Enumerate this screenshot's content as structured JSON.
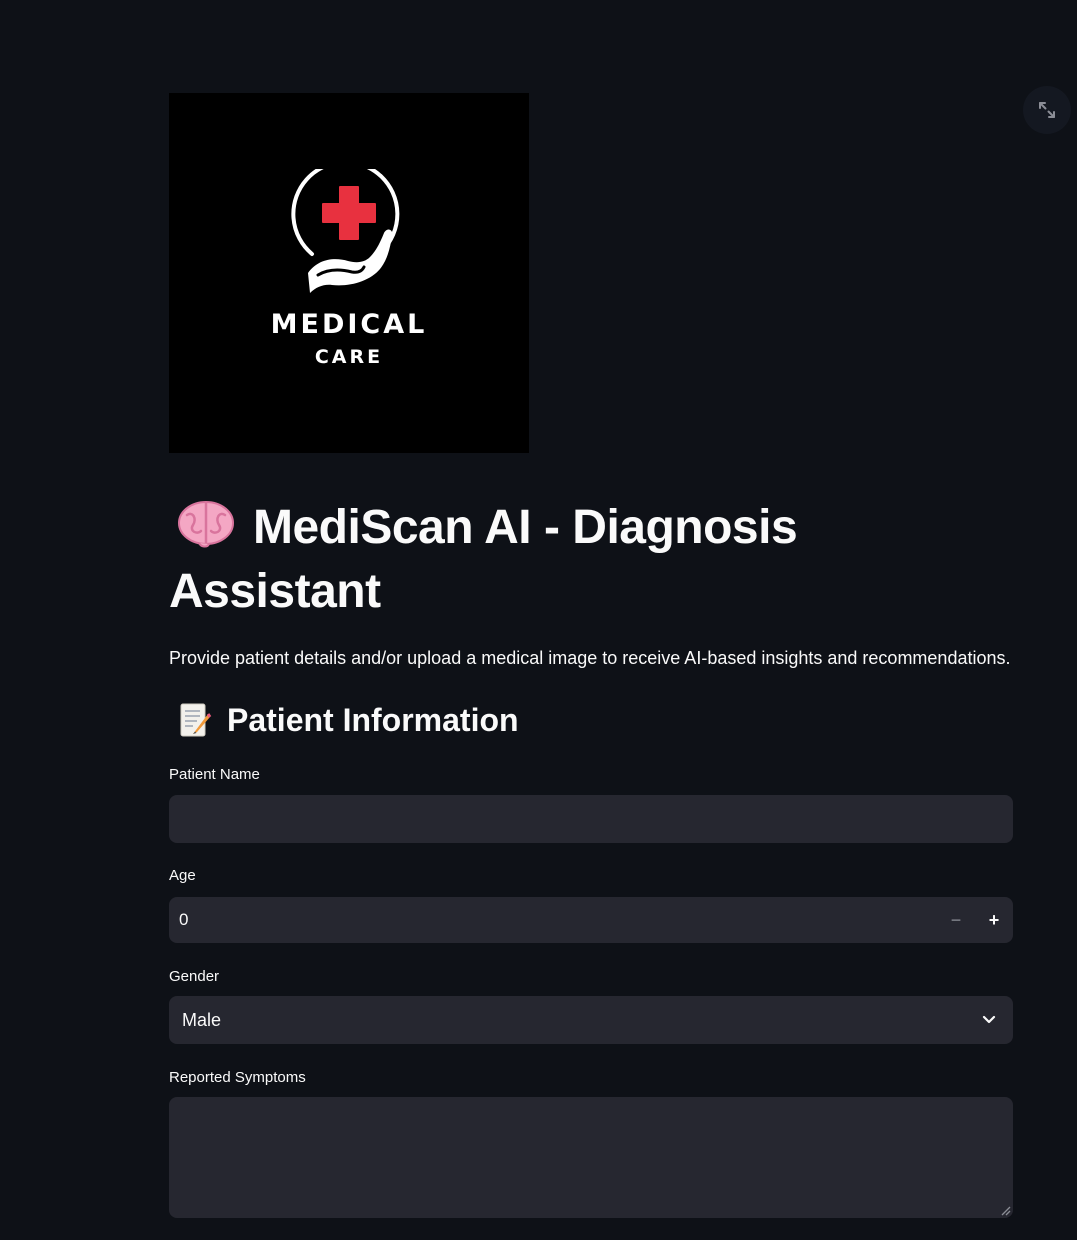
{
  "toolbar": {
    "fullscreen_icon": "expand-arrows-icon"
  },
  "logo": {
    "word1": "MEDICAL",
    "word2": "CARE",
    "icon": "hand-holding-medical-cross-icon",
    "cross_color": "#e8313f"
  },
  "header": {
    "emoji": "brain-icon",
    "title": "MediScan AI - Diagnosis Assistant",
    "subtitle": "Provide patient details and/or upload a medical image to receive AI-based insights and recommendations."
  },
  "patient_section": {
    "emoji": "memo-icon",
    "title": "Patient Information",
    "name_label": "Patient Name",
    "name_value": "",
    "age_label": "Age",
    "age_value": "0",
    "age_minus": "−",
    "age_plus": "+",
    "gender_label": "Gender",
    "gender_value": "Male",
    "symptoms_label": "Reported Symptoms",
    "symptoms_value": ""
  },
  "colors": {
    "background": "#0e1117",
    "input_bg": "#262730",
    "text": "#fafafa"
  }
}
